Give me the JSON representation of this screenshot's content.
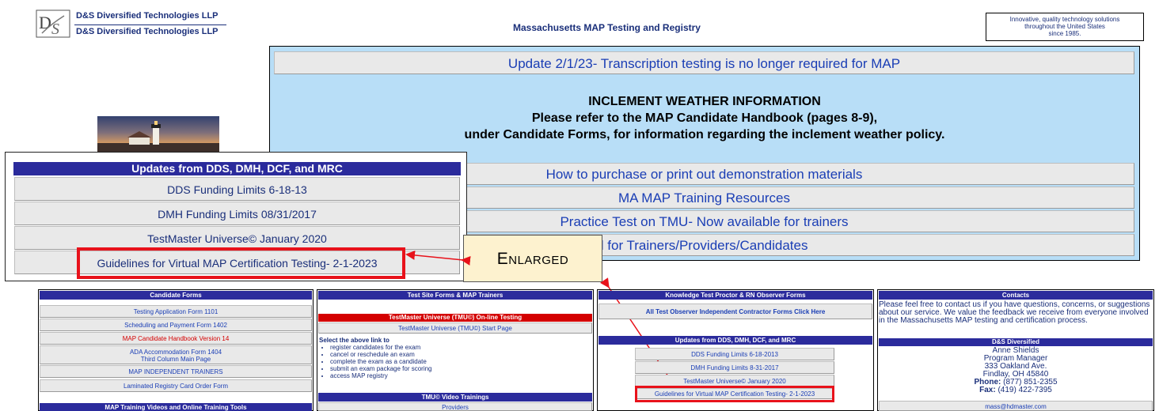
{
  "header": {
    "company_line1": "D&S Diversified Technologies LLP",
    "company_line2": "D&S Diversified Technologies LLP",
    "site_title": "Massachusetts MAP Testing and Registry",
    "tagline_1": "Innovative, quality technology solutions",
    "tagline_2": "throughout the United States",
    "tagline_3": "since 1985."
  },
  "notice": {
    "update_link": "Update 2/1/23- Transcription testing is no longer required for MAP",
    "weather_title": "INCLEMENT WEATHER INFORMATION",
    "weather_line1": "Please refer to the MAP Candidate Handbook (pages 8-9),",
    "weather_line2": "under Candidate Forms, for information regarding the inclement weather policy.",
    "links": [
      "How to purchase or print out demonstration materials",
      "MA MAP Training Resources",
      "Practice Test on TMU- Now available for trainers",
      "Tutorial for Trainers/Providers/Candidates"
    ]
  },
  "enlarged_panel": {
    "title": "Updates from DDS, DMH, DCF, and MRC",
    "items": [
      "DDS Funding Limits 6-18-13",
      "DMH Funding Limits 08/31/2017",
      "TestMaster Universe© January 2020",
      "Guidelines for Virtual MAP Certification Testing- 2-1-2023"
    ]
  },
  "callout": {
    "label": "Enlarged"
  },
  "candidate_forms": {
    "title": "Candidate Forms",
    "items": [
      "Testing Application Form 1101",
      "Scheduling and Payment Form 1402",
      "MAP Candidate Handbook Version 14",
      "ADA Accommodation Form 1404",
      "Third Column Main Page",
      "MAP INDEPENDENT TRAINERS",
      "Laminated Registry Card Order Form"
    ],
    "bottom_title": "MAP Training Videos and Online Training Tools"
  },
  "test_site": {
    "title": "Test Site Forms & MAP Trainers",
    "tmu_title": "TestMaster Universe (TMU©) On-line Testing",
    "tmu_start": "TestMaster Universe (TMU©) Start Page",
    "select_text": "Select the above link to",
    "bullets": [
      "register candidates for the exam",
      "cancel or reschedule an exam",
      "complete the exam as a candidate",
      "submit an exam package for scoring",
      "access MAP registry"
    ],
    "video_title": "TMU© Video Trainings",
    "providers": "Providers"
  },
  "proctor": {
    "title": "Knowledge Test Proctor & RN Observer Forms",
    "observer_link": "All Test Observer Independent Contractor Forms Click Here",
    "updates_title": "Updates from DDS, DMH, DCF, and MRC",
    "items": [
      "DDS Funding Limits 6-18-2013",
      "DMH Funding Limits 8-31-2017",
      "TestMaster Universe© January 2020",
      "Guidelines for Virtual MAP Certification Testing- 2-1-2023"
    ]
  },
  "contacts": {
    "title": "Contacts",
    "intro": "Please feel free to contact us if you have questions, concerns, or suggestions about our service. We value the feedback we receive from everyone involved in the Massachusetts MAP testing and certification process.",
    "org_title": "D&S Diversified",
    "name": "Anne Shields",
    "role": "Program Manager",
    "address1": "333 Oakland Ave.",
    "address2": "Findlay, OH 45840",
    "phone_label": "Phone:",
    "phone": "(877) 851-2355",
    "fax_label": "Fax:",
    "fax": "(419) 422-7395",
    "email": "mass@hdmaster.com"
  },
  "colors": {
    "header_blue": "#2b2b9c",
    "link_blue": "#1a3eb5",
    "alert_red": "#d40000",
    "notice_bg": "#b8def7",
    "callout_bg": "#fdf2cf",
    "highlight_red": "#e8121b"
  }
}
